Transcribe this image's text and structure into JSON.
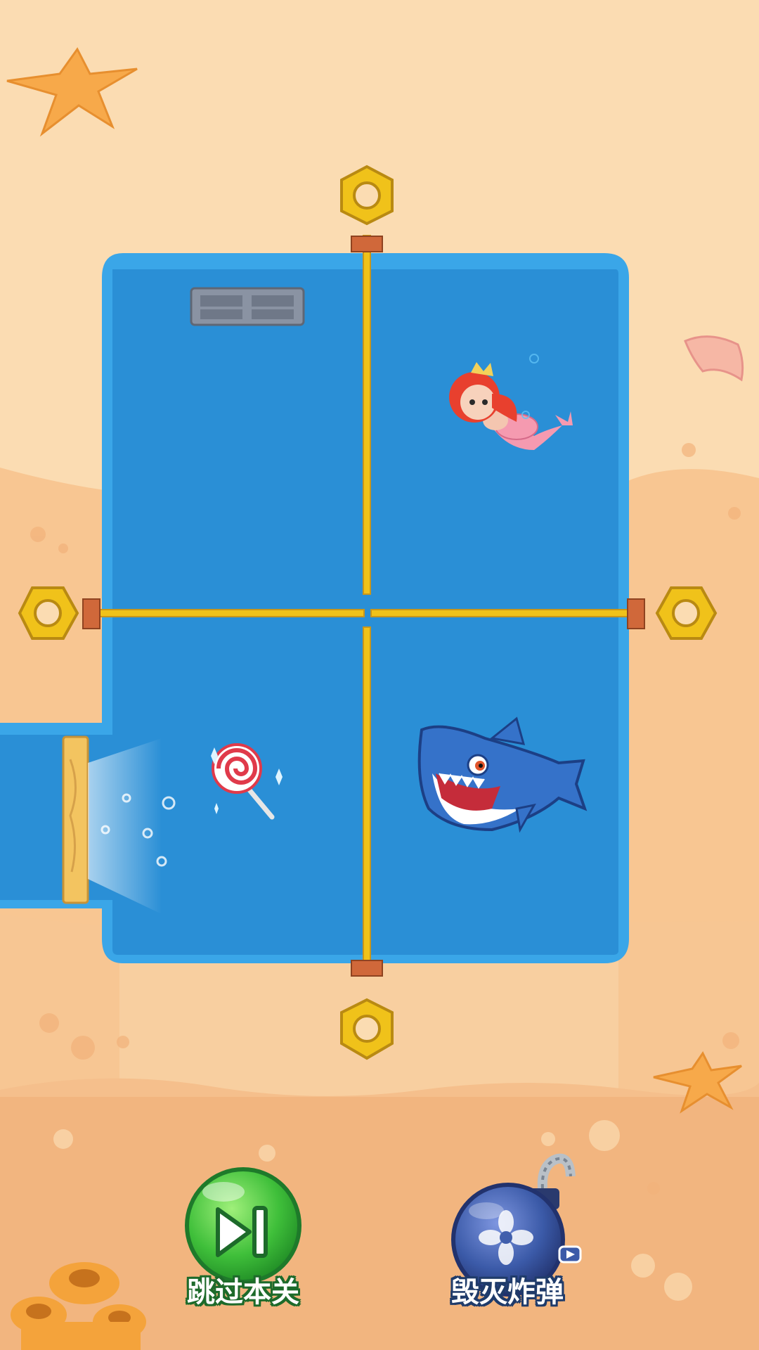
{
  "buttons": {
    "skip_level": {
      "label": "跳过本关",
      "icon": "skip-next-icon",
      "color": "#3fbf3a"
    },
    "bomb": {
      "label": "毁灭炸弹",
      "icon": "bomb-icon",
      "color": "#3b5aa8",
      "badge_icon": "video-play-icon"
    }
  },
  "colors": {
    "sand_light": "#fbdcb2",
    "sand_dark": "#f2b57f",
    "water": "#2a8fd6",
    "water_border": "#3aa6e8",
    "pin_gold": "#f0c21a",
    "pin_rod": "#e8b820"
  },
  "characters": [
    "mermaid-princess",
    "shark",
    "lollipop"
  ]
}
